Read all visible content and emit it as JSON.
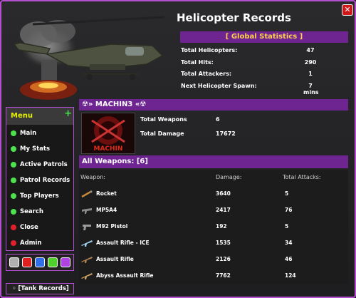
{
  "window": {
    "title": "Helicopter Records",
    "close_glyph": "✕"
  },
  "global_stats": {
    "header": "[ Global Statistics ]",
    "rows": [
      {
        "label": "Total Helicopters:",
        "value": "47"
      },
      {
        "label": "Total Hits:",
        "value": "290"
      },
      {
        "label": "Total Attackers:",
        "value": "1"
      },
      {
        "label": "Next Helicopter Spawn:",
        "value": "7 mins"
      }
    ]
  },
  "menu": {
    "title": "Menu",
    "plus": "+",
    "items": [
      {
        "label": "Main",
        "color": "#4ee14e"
      },
      {
        "label": "My Stats",
        "color": "#4ee14e"
      },
      {
        "label": "Active Patrols",
        "color": "#4ee14e"
      },
      {
        "label": "Patrol Records",
        "color": "#4ee14e"
      },
      {
        "label": "Top Players",
        "color": "#4ee14e"
      },
      {
        "label": "Search",
        "color": "#4ee14e"
      },
      {
        "label": "Close",
        "color": "#e0202a"
      },
      {
        "label": "Admin",
        "color": "#e0202a"
      }
    ]
  },
  "color_swatches": [
    "#b0b0b0",
    "#e02020",
    "#2f6fe8",
    "#4fd02a",
    "#b144e0"
  ],
  "tank_button": "◦ [Tank Records]",
  "user": {
    "name": "☢» MACHIN3 «☢",
    "avatar_text": "MACHIN",
    "stats": [
      {
        "label": "Total Weapons",
        "value": "6"
      },
      {
        "label": "Total Damage",
        "value": "17672"
      }
    ]
  },
  "weapons": {
    "header": "All Weapons: [6]",
    "columns": {
      "weapon": "Weapon:",
      "damage": "Damage:",
      "attacks": "Total Attacks:"
    },
    "rows": [
      {
        "name": "Rocket",
        "damage": "3640",
        "attacks": "5",
        "icon": "rocket-icon"
      },
      {
        "name": "MP5A4",
        "damage": "2417",
        "attacks": "76",
        "icon": "smg-icon"
      },
      {
        "name": "M92 Pistol",
        "damage": "192",
        "attacks": "5",
        "icon": "pistol-icon"
      },
      {
        "name": "Assault Rifle - ICE",
        "damage": "1535",
        "attacks": "34",
        "icon": "rifle-ice-icon"
      },
      {
        "name": "Assault Rifle",
        "damage": "2126",
        "attacks": "46",
        "icon": "rifle-icon"
      },
      {
        "name": "Abyss Assault Rifle",
        "damage": "7762",
        "attacks": "124",
        "icon": "rifle-abyss-icon"
      }
    ]
  }
}
